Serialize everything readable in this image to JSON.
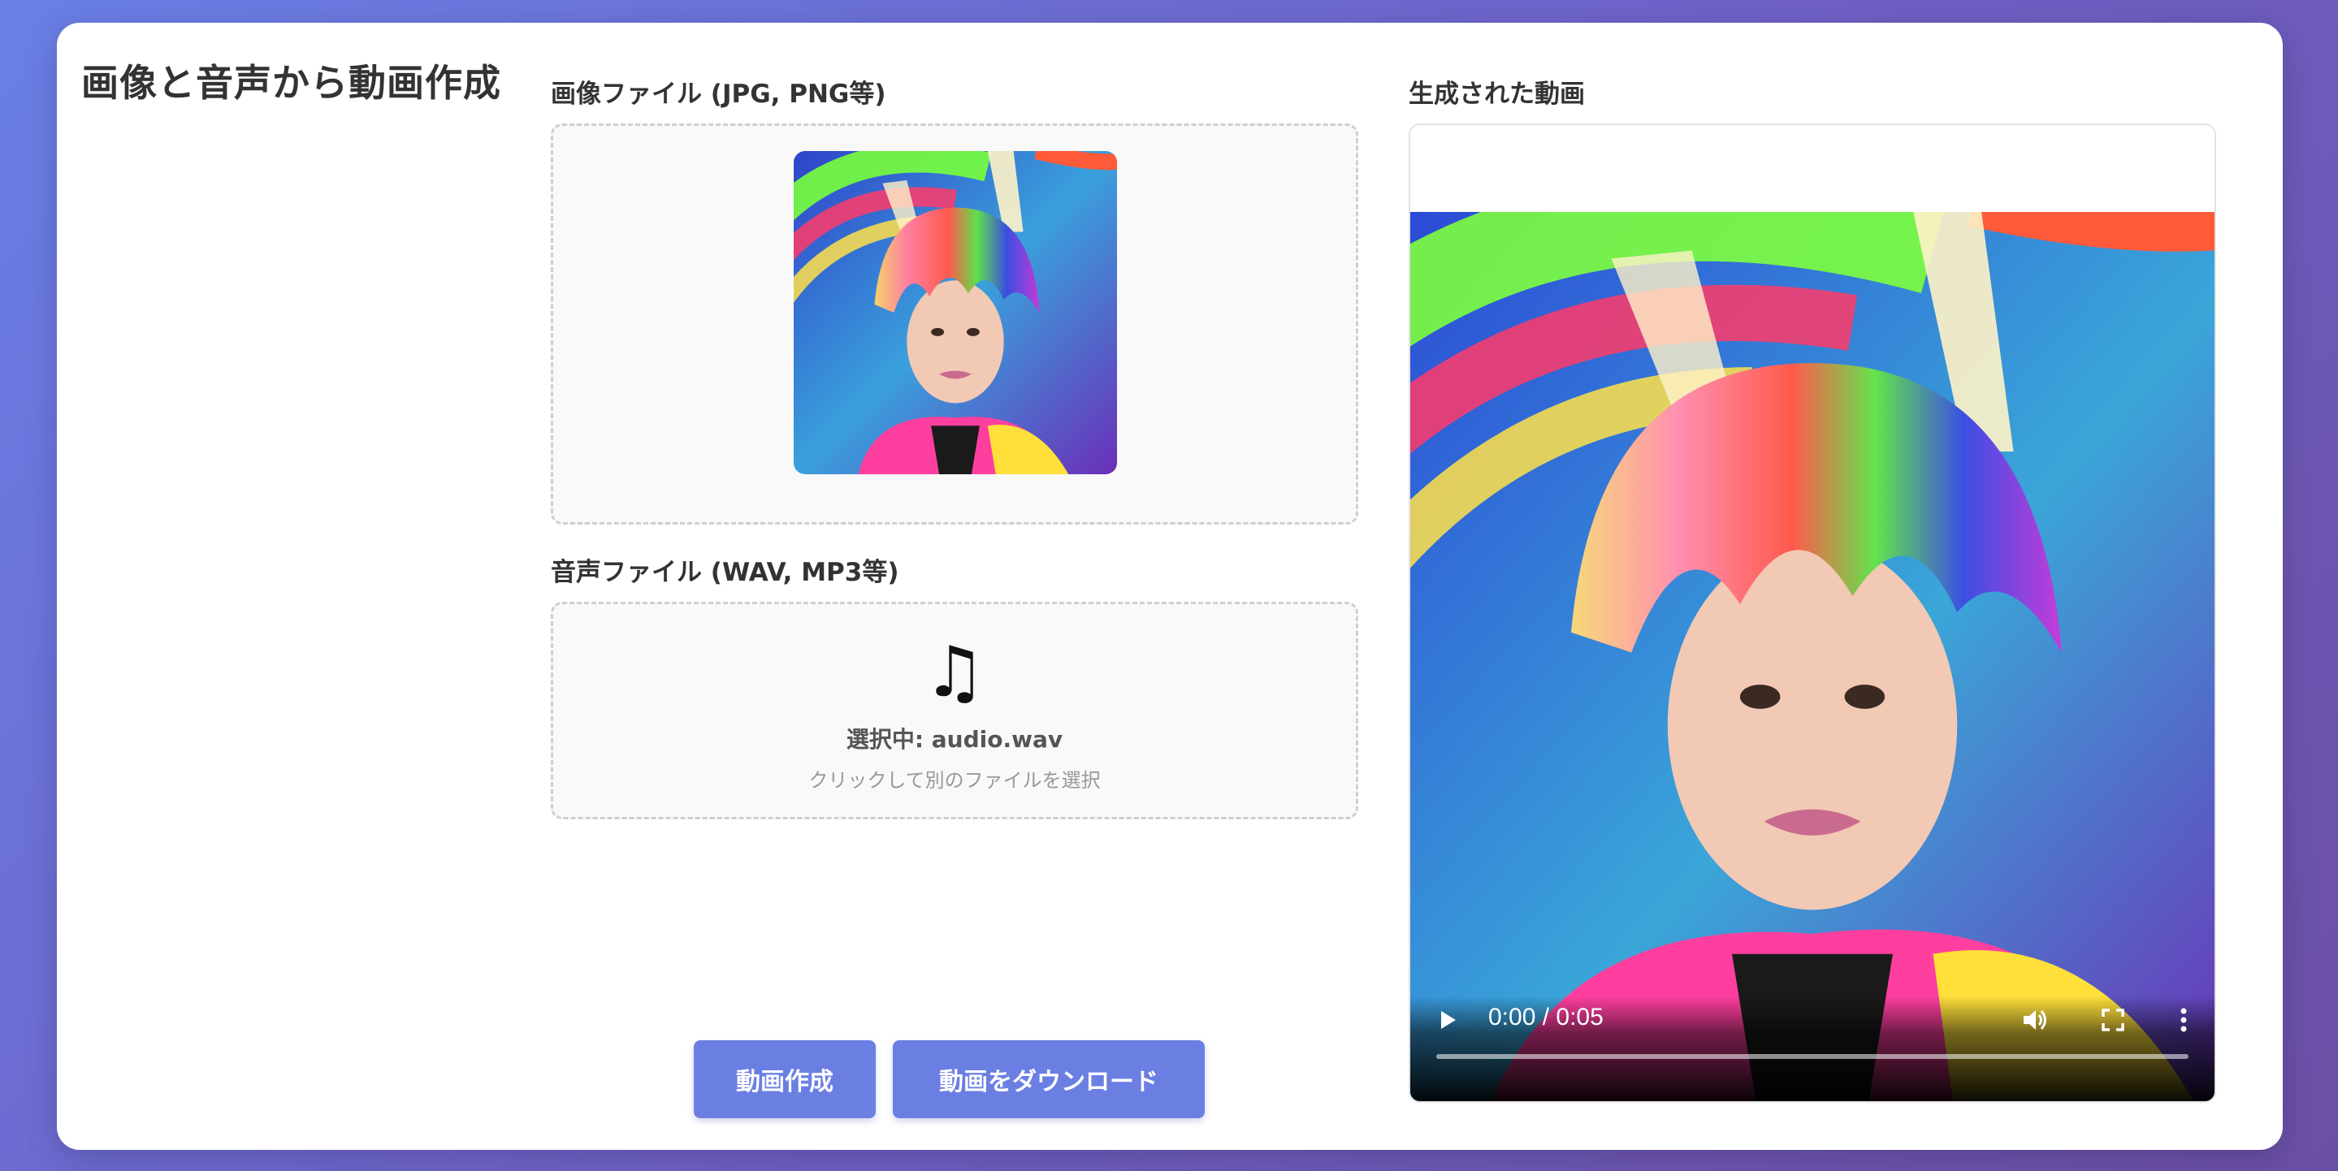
{
  "app": {
    "title": "画像と音声から動画作成"
  },
  "image_input": {
    "label": "画像ファイル (JPG, PNG等)",
    "preview_alt": "uploaded-portrait"
  },
  "audio_input": {
    "label": "音声ファイル (WAV, MP3等)",
    "icon": "music-note-icon",
    "icon_glyph": "♫",
    "selected_text": "選択中: audio.wav",
    "hint_text": "クリックして別のファイルを選択"
  },
  "actions": {
    "create_label": "動画作成",
    "download_label": "動画をダウンロード"
  },
  "output": {
    "label": "生成された動画",
    "player": {
      "time_text": "0:00 / 0:05",
      "progress_fraction": 0
    }
  },
  "colors": {
    "accent": "#6b7fe3",
    "background_gradient": [
      "#6a7fe6",
      "#6b4fa6"
    ]
  }
}
